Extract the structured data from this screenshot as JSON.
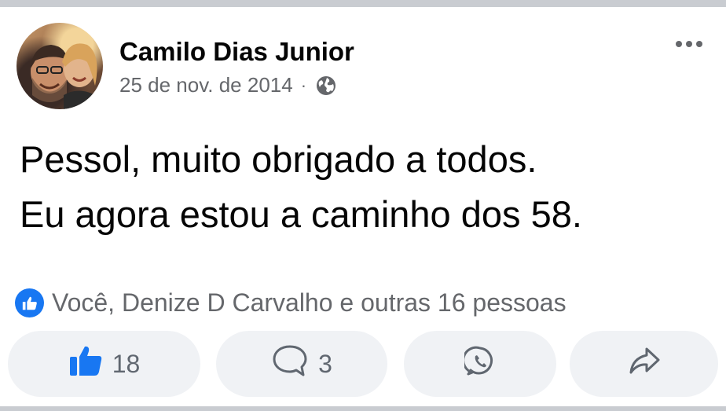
{
  "post": {
    "author": "Camilo Dias Junior",
    "date": "25 de nov. de 2014",
    "separator": "·",
    "visibility_icon": "globe-icon",
    "more_icon": "more-options-icon",
    "text_lines": [
      "Pessol, muito obrigado a todos.",
      "Eu agora estou a caminho dos 58."
    ],
    "reactions_summary": "Você, Denize D Carvalho e outras 16 pessoas",
    "reaction_icon": "like-icon"
  },
  "actions": {
    "like_count": "18",
    "comment_count": "3",
    "whatsapp_icon": "whatsapp-icon",
    "share_icon": "share-icon"
  },
  "colors": {
    "accent": "#1877f2",
    "secondary_text": "#65676b",
    "button_bg": "#f0f2f5",
    "divider": "#c9ccd1"
  }
}
